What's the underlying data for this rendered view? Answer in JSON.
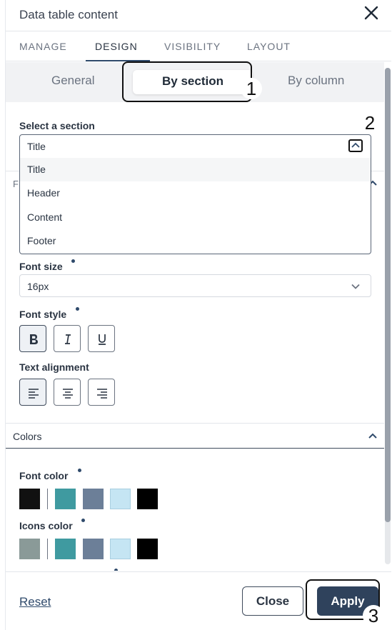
{
  "header": {
    "title": "Data table content"
  },
  "tabs": [
    {
      "label": "MANAGE"
    },
    {
      "label": "DESIGN",
      "active": true
    },
    {
      "label": "VISIBILITY"
    },
    {
      "label": "LAYOUT"
    }
  ],
  "segmented": {
    "general": "General",
    "by_section": "By section",
    "by_column": "By column",
    "selected": "By section"
  },
  "section_select": {
    "label": "Select a section",
    "value": "Title",
    "options": [
      "Title",
      "Header",
      "Content",
      "Footer"
    ],
    "expanded": true
  },
  "hidden_accordion": {
    "partial_label": "F"
  },
  "font_size": {
    "label": "Font size",
    "value": "16px"
  },
  "font_style": {
    "label": "Font style",
    "bold": "B",
    "italic": "I",
    "underline": "U",
    "selected": "bold"
  },
  "text_alignment": {
    "label": "Text alignment",
    "selected": "left"
  },
  "colors_accordion": {
    "title": "Colors",
    "expanded": true
  },
  "font_color": {
    "label": "Font color",
    "swatches": [
      "#111111",
      "#3f9aa0",
      "#6c7f98",
      "#c5e5f3",
      "#000000"
    ]
  },
  "icons_color": {
    "label": "Icons color",
    "swatches": [
      "#8a9a98",
      "#3f9aa0",
      "#6c7f98",
      "#c5e5f3",
      "#000000"
    ]
  },
  "footer": {
    "reset": "Reset",
    "close": "Close",
    "apply": "Apply"
  },
  "annotations": {
    "one": "1",
    "two": "2",
    "three": "3"
  },
  "colors": {
    "primary": "#2f425c",
    "text": "#2a3442",
    "muted": "#6b7380"
  }
}
